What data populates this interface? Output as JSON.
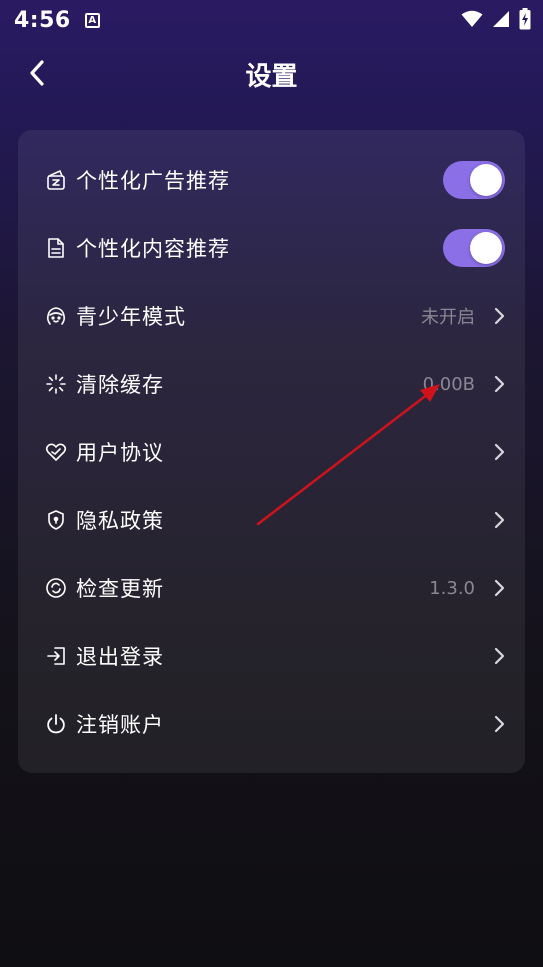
{
  "status_bar": {
    "time": "4:56",
    "notification_letter": "A",
    "icons": [
      "wifi-icon",
      "cellular-signal-icon",
      "battery-charging-icon"
    ]
  },
  "header": {
    "title": "设置",
    "back_icon": "chevron-left-icon"
  },
  "settings": [
    {
      "id": "personalized-ads",
      "label": "个性化广告推荐",
      "icon": "ad-icon",
      "toggle": true,
      "value": ""
    },
    {
      "id": "personalized-content",
      "label": "个性化内容推荐",
      "icon": "document-icon",
      "toggle": true,
      "value": ""
    },
    {
      "id": "teen-mode",
      "label": "青少年模式",
      "icon": "teen-face-icon",
      "toggle": false,
      "value": "未开启"
    },
    {
      "id": "clear-cache",
      "label": "清除缓存",
      "icon": "sparkle-icon",
      "toggle": false,
      "value": "0.00B"
    },
    {
      "id": "user-agreement",
      "label": "用户协议",
      "icon": "heart-handshake-icon",
      "toggle": false,
      "value": ""
    },
    {
      "id": "privacy-policy",
      "label": "隐私政策",
      "icon": "shield-icon",
      "toggle": false,
      "value": ""
    },
    {
      "id": "check-update",
      "label": "检查更新",
      "icon": "refresh-icon",
      "toggle": false,
      "value": "1.3.0"
    },
    {
      "id": "logout",
      "label": "退出登录",
      "icon": "logout-icon",
      "toggle": false,
      "value": ""
    },
    {
      "id": "delete-account",
      "label": "注销账户",
      "icon": "power-icon",
      "toggle": false,
      "value": ""
    }
  ],
  "colors": {
    "toggle_on": "#8b6fe6",
    "annotation_arrow": "#d0121b"
  }
}
